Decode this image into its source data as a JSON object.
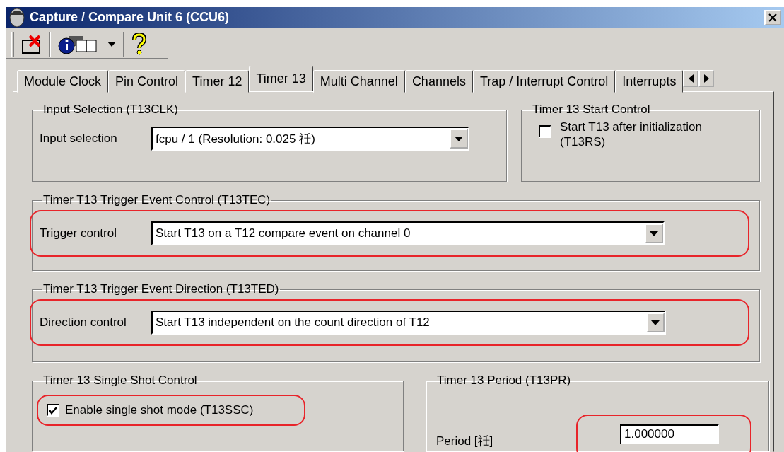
{
  "window": {
    "title": "Capture / Compare Unit 6 (CCU6)"
  },
  "tabs": [
    {
      "label": "Module Clock",
      "selected": false
    },
    {
      "label": "Pin Control",
      "selected": false
    },
    {
      "label": "Timer 12",
      "selected": false
    },
    {
      "label": "Timer 13",
      "selected": true
    },
    {
      "label": "Multi Channel",
      "selected": false
    },
    {
      "label": "Channels",
      "selected": false
    },
    {
      "label": "Trap / Interrupt Control",
      "selected": false
    },
    {
      "label": "Interrupts",
      "selected": false
    }
  ],
  "input_selection": {
    "title": "Input Selection (T13CLK)",
    "label": "Input selection",
    "value": "fcpu / 1 (Resolution: 0.025 祍)",
    "highlighted": false
  },
  "start_control": {
    "title": "Timer 13 Start Control",
    "label": "Start T13 after initialization (T13RS)",
    "checked": false
  },
  "trigger_control": {
    "title": "Timer T13 Trigger Event Control (T13TEC)",
    "label": "Trigger control",
    "value": "Start T13 on a T12 compare event on channel 0",
    "highlighted": true
  },
  "direction_control": {
    "title": "Timer T13 Trigger Event Direction (T13TED)",
    "label": "Direction control",
    "value": "Start T13 independent on the count direction of T12",
    "highlighted": true
  },
  "single_shot": {
    "title": "Timer 13 Single Shot Control",
    "label": "Enable single shot mode (T13SSC)",
    "checked": true,
    "highlighted": true
  },
  "period": {
    "title": "Timer 13 Period (T13PR)",
    "label": "Period [祍]",
    "value": "1.000000",
    "highlighted": true
  }
}
